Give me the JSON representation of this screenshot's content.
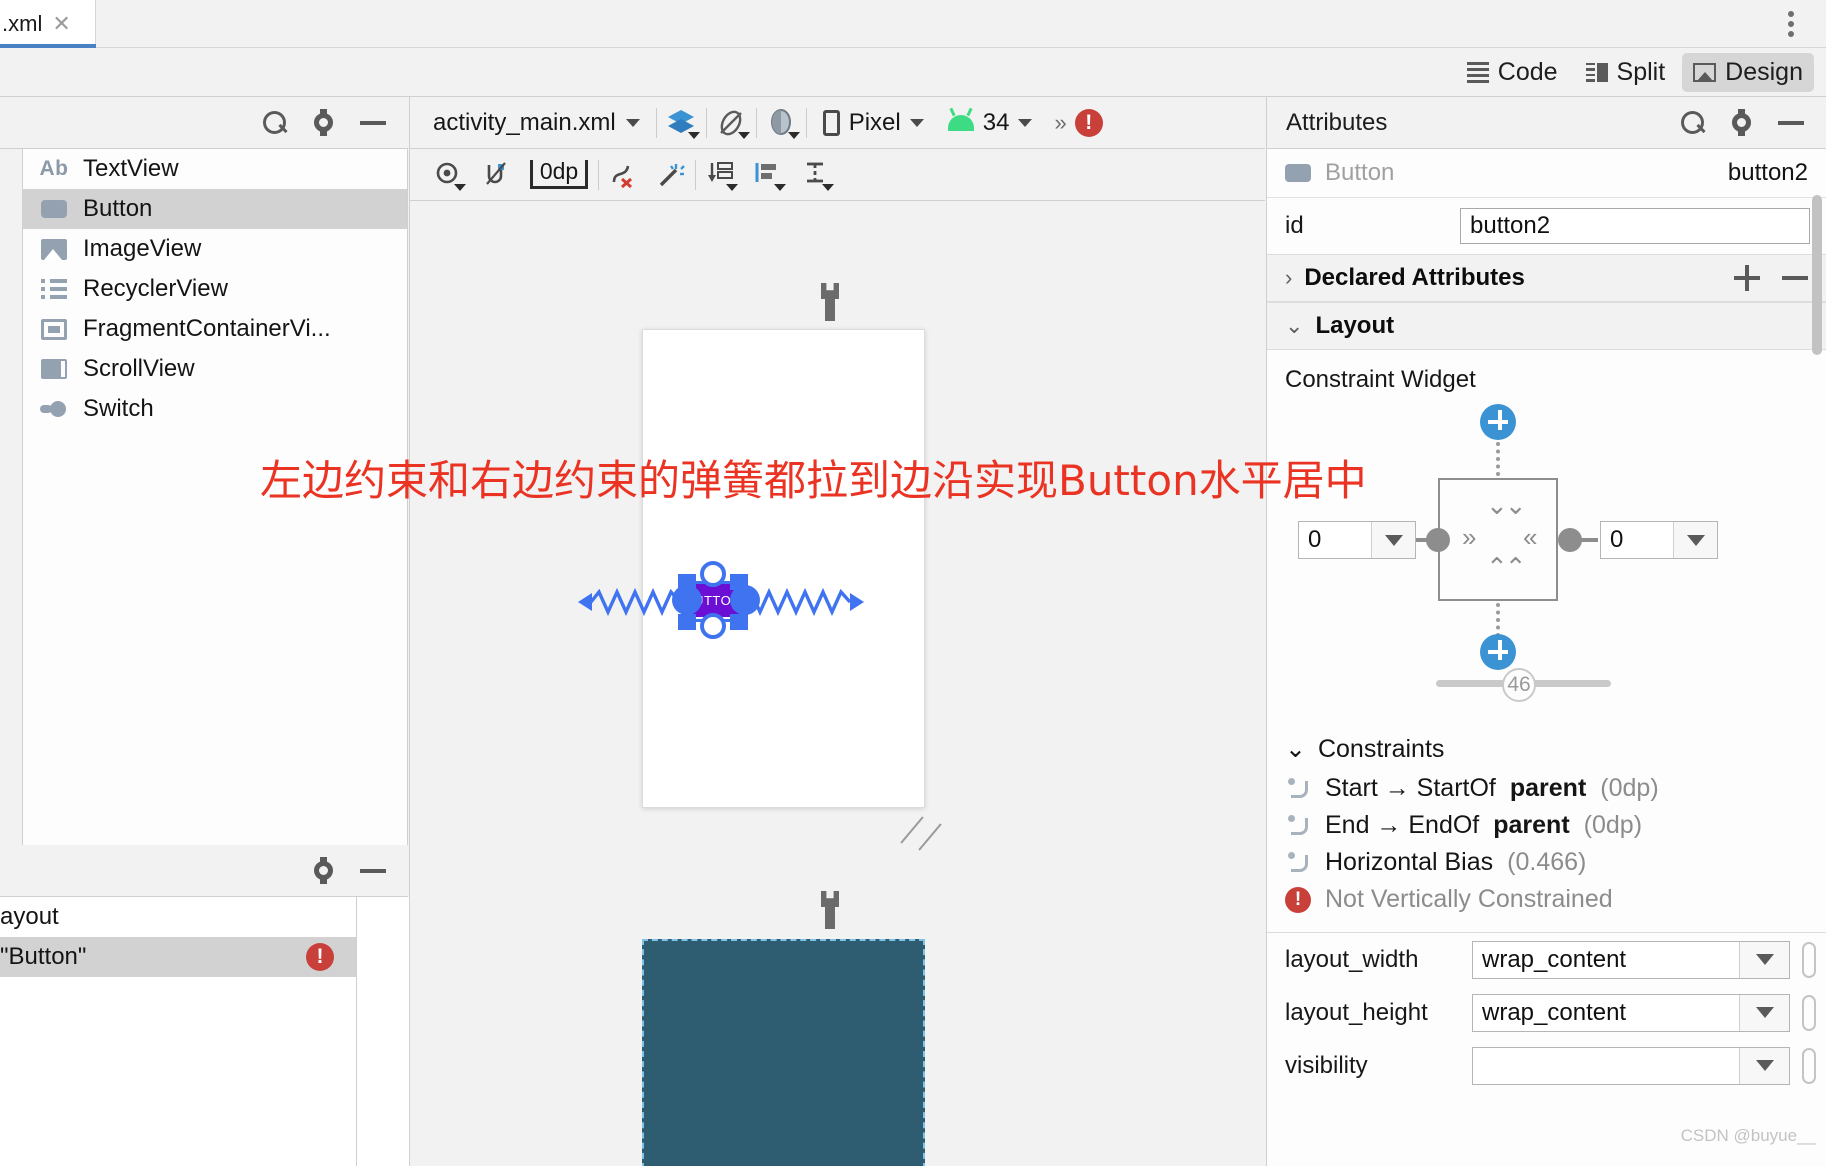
{
  "tab": {
    "label": ".xml",
    "close_icon": "close-icon"
  },
  "window": {
    "kebab_icon": "more-vertical-icon"
  },
  "modes": [
    {
      "label": "Code",
      "icon": "code-lines-icon",
      "active": false
    },
    {
      "label": "Split",
      "icon": "split-view-icon",
      "active": false
    },
    {
      "label": "Design",
      "icon": "design-image-icon",
      "active": true
    }
  ],
  "palette": {
    "title": "",
    "search_icon": "search-icon",
    "gear_icon": "gear-icon",
    "minimize_icon": "minimize-icon",
    "items": [
      {
        "label": "TextView",
        "icon": "textview-ab-icon",
        "selected": false
      },
      {
        "label": "Button",
        "icon": "button-icon",
        "selected": true
      },
      {
        "label": "ImageView",
        "icon": "imageview-icon",
        "selected": false
      },
      {
        "label": "RecyclerView",
        "icon": "recyclerview-list-icon",
        "selected": false
      },
      {
        "label": "FragmentContainerVi...",
        "icon": "fragment-container-icon",
        "selected": false
      },
      {
        "label": "ScrollView",
        "icon": "scrollview-icon",
        "selected": false
      },
      {
        "label": "Switch",
        "icon": "switch-icon",
        "selected": false
      }
    ]
  },
  "component_tree": {
    "gear_icon": "gear-icon",
    "minimize_icon": "minimize-icon",
    "rows": [
      {
        "label": "ayout",
        "selected": false,
        "error": false
      },
      {
        "label": "\"Button\"",
        "selected": true,
        "error": true,
        "error_icon": "error-icon"
      }
    ]
  },
  "design_surface": {
    "file_name": "activity_main.xml",
    "file_caret_icon": "chevron-down-icon",
    "layers_icon": "design-mode-icon",
    "orientation_icon": "rotate-orientation-icon",
    "theme_icon": "theme-icon",
    "device_name": "Pixel",
    "device_icon": "phone-icon",
    "api_level": "34",
    "api_icon": "android-icon",
    "overflow_icon": "chevron-double-right-icon",
    "issue_count_icon": "error-icon",
    "tools": [
      {
        "name": "view-options-icon",
        "label": ""
      },
      {
        "name": "autoconnect-icon",
        "label": ""
      },
      {
        "name": "default-margin-icon",
        "label": "0dp"
      },
      {
        "name": "clear-constraints-icon",
        "label": ""
      },
      {
        "name": "infer-constraints-icon",
        "label": ""
      },
      {
        "name": "pack-icon",
        "label": ""
      },
      {
        "name": "align-icon",
        "label": ""
      },
      {
        "name": "guidelines-icon",
        "label": ""
      }
    ],
    "widget_label": "BUTTON",
    "annotation": "左边约束和右边约束的弹簧都拉到边沿实现Button水平居中",
    "annotation_color": "#ea3323",
    "blueprint_color": "#2e5c70"
  },
  "attributes": {
    "title": "Attributes",
    "search_icon": "search-icon",
    "gear_icon": "gear-icon",
    "minimize_icon": "minimize-icon",
    "selected_type": "Button",
    "selected_type_icon": "button-icon",
    "selected_id": "button2",
    "id_label": "id",
    "id_value": "button2",
    "sections": {
      "declared": {
        "label": "Declared Attributes",
        "expanded": false,
        "expand_icon": "chevron-right-icon",
        "add_icon": "plus-icon",
        "remove_icon": "minus-icon"
      },
      "layout": {
        "label": "Layout",
        "expanded": true,
        "expand_icon": "chevron-down-icon"
      },
      "constraints": {
        "label": "Constraints",
        "expanded": true,
        "expand_icon": "chevron-down-icon"
      }
    },
    "constraint_widget": {
      "title": "Constraint Widget",
      "left_margin": "0",
      "right_margin": "0",
      "left_dropdown_icon": "chevron-down-icon",
      "right_dropdown_icon": "chevron-down-icon",
      "top_add_icon": "add-constraint-icon",
      "bottom_add_icon": "add-constraint-icon",
      "horizontal_bias": "46",
      "left_spring_icon": "spring-right-icon",
      "right_spring_icon": "spring-left-icon",
      "top_chevron_icon": "chevron-double-down-icon",
      "bottom_chevron_icon": "chevron-double-up-icon"
    },
    "constraint_rows": [
      {
        "icon": "constraint-icon",
        "text": "Start → StartOf ",
        "bold": "parent",
        "dim": " (0dp)",
        "warn": false
      },
      {
        "icon": "constraint-icon",
        "text": "End → EndOf ",
        "bold": "parent",
        "dim": " (0dp)",
        "warn": false
      },
      {
        "icon": "constraint-icon",
        "text": "Horizontal Bias ",
        "bold": "",
        "dim": " (0.466)",
        "warn": false
      },
      {
        "icon": "error-icon",
        "text": "Not Vertically Constrained",
        "bold": "",
        "dim": "",
        "warn": true
      }
    ],
    "properties": [
      {
        "label": "layout_width",
        "value": "wrap_content",
        "dropdown_icon": "chevron-down-icon"
      },
      {
        "label": "layout_height",
        "value": "wrap_content",
        "dropdown_icon": "chevron-down-icon"
      },
      {
        "label": "visibility",
        "value": "",
        "dropdown_icon": "chevron-down-icon"
      }
    ]
  },
  "watermark": "CSDN @buyue__"
}
